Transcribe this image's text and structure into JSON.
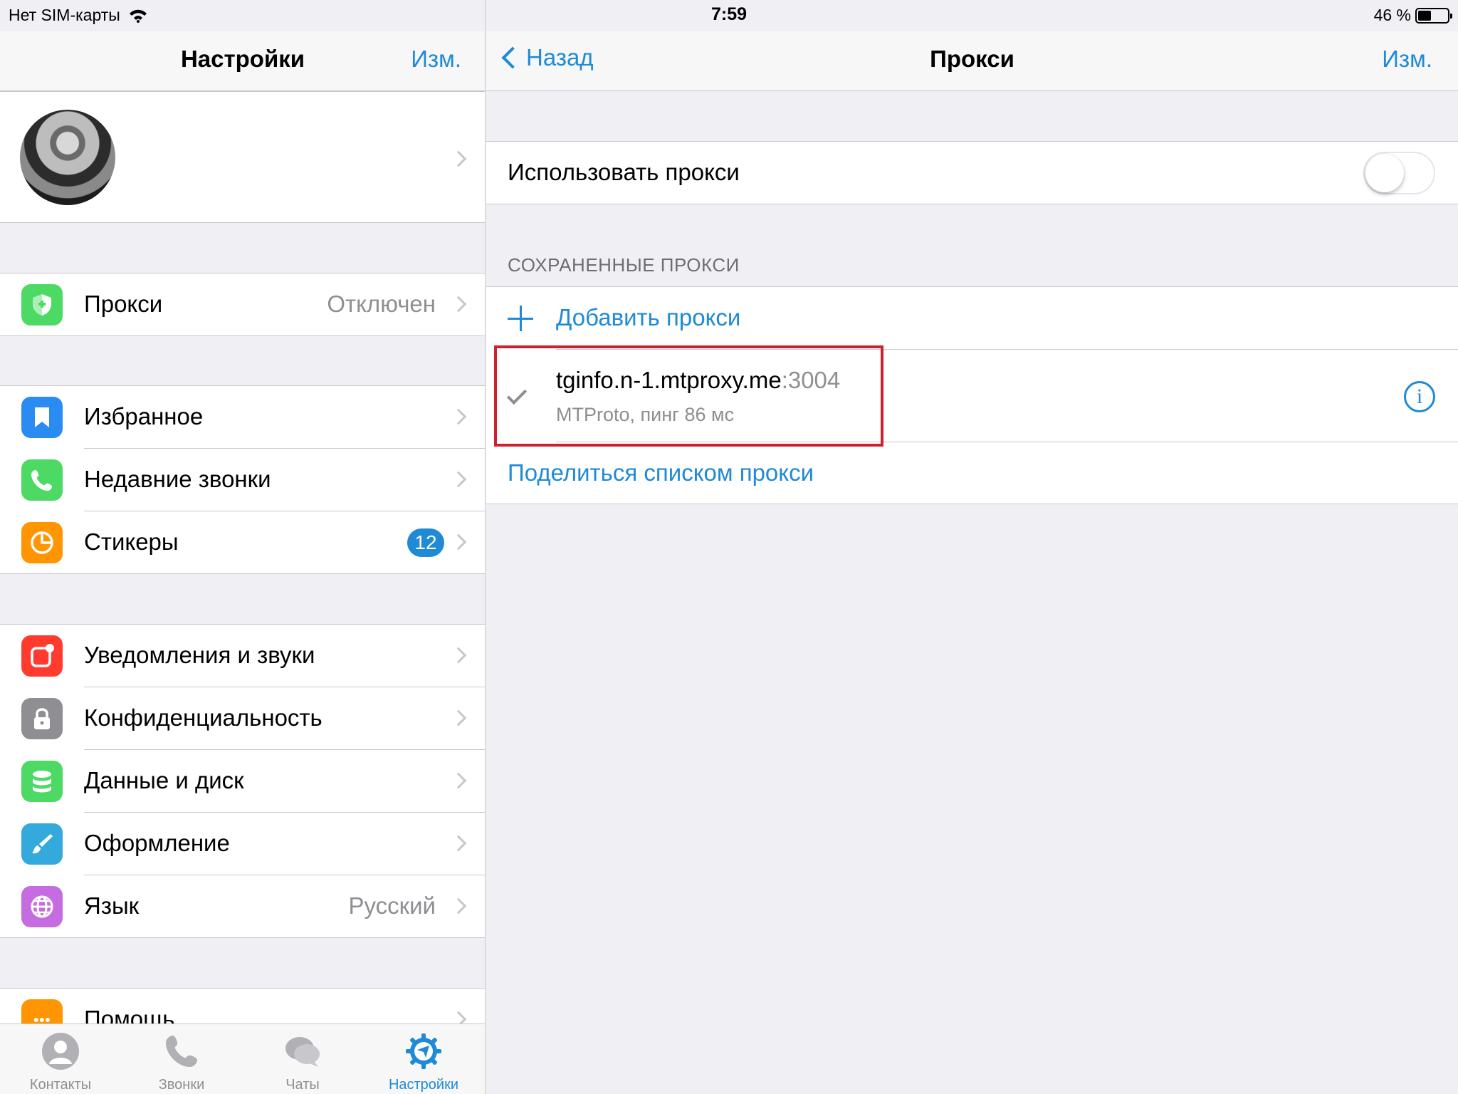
{
  "status_bar": {
    "carrier": "Нет SIM-карты",
    "time": "7:59",
    "battery_text": "46 %",
    "battery_level": 0.46
  },
  "settings": {
    "title": "Настройки",
    "edit": "Изм.",
    "proxy_row": {
      "label": "Прокси",
      "value": "Отключен",
      "icon": "shield-icon"
    },
    "group2": [
      {
        "label": "Избранное",
        "icon": "bookmark-icon",
        "color": "#2a8cf2"
      },
      {
        "label": "Недавние звонки",
        "icon": "phone-icon",
        "color": "#4cd964"
      },
      {
        "label": "Стикеры",
        "icon": "sticker-icon",
        "color": "#ff9500",
        "badge": "12"
      }
    ],
    "group3": [
      {
        "label": "Уведомления и звуки",
        "icon": "notification-icon",
        "color": "#ff3b30"
      },
      {
        "label": "Конфиденциальность",
        "icon": "lock-icon",
        "color": "#8e8e93"
      },
      {
        "label": "Данные и диск",
        "icon": "database-icon",
        "color": "#4cd964"
      },
      {
        "label": "Оформление",
        "icon": "brush-icon",
        "color": "#34aadc"
      },
      {
        "label": "Язык",
        "value": "Русский",
        "icon": "globe-icon",
        "color": "#c56de0"
      }
    ],
    "help": {
      "label": "Помощь",
      "icon": "chat-bubble-icon",
      "color": "#ff9500"
    }
  },
  "tabbar": [
    {
      "label": "Контакты",
      "icon": "contacts-icon",
      "active": false
    },
    {
      "label": "Звонки",
      "icon": "phone-icon",
      "active": false
    },
    {
      "label": "Чаты",
      "icon": "chats-icon",
      "active": false
    },
    {
      "label": "Настройки",
      "icon": "settings-gear-icon",
      "active": true
    }
  ],
  "proxy_page": {
    "back": "Назад",
    "title": "Прокси",
    "edit": "Изм.",
    "use_proxy_label": "Использовать прокси",
    "use_proxy_enabled": false,
    "saved_header": "СОХРАНЕННЫЕ ПРОКСИ",
    "add_label": "Добавить прокси",
    "proxy": {
      "host": "tginfo.n-1.mtproxy.me",
      "port": ":3004",
      "meta": "MTProto, пинг 86 мс"
    },
    "share_label": "Поделиться списком прокси"
  },
  "colors": {
    "accent": "#1f8ad6",
    "highlight": "#d0202e"
  }
}
